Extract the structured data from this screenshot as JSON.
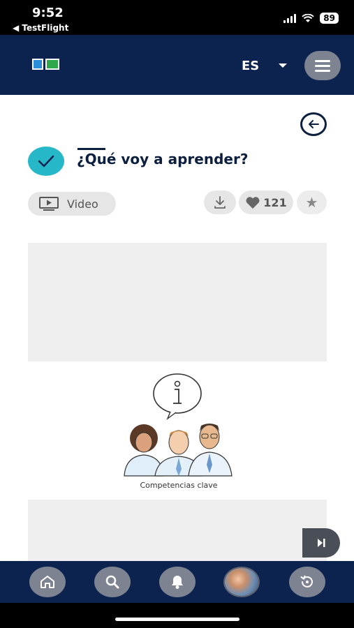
{
  "status_bar": {
    "time": "9:52",
    "back_app": "◀ TestFlight",
    "battery": "89"
  },
  "header": {
    "language": "ES",
    "brand_colors": {
      "navy": "#0c2350",
      "teal": "#26b8c8"
    }
  },
  "lesson": {
    "title": "¿Qué voy a aprender?",
    "media_type_label": "Video",
    "likes": "121"
  },
  "illustration": {
    "caption": "Competencias clave"
  },
  "icons": {
    "back": "arrow-left-icon",
    "check": "check-icon",
    "video": "video-icon",
    "download": "download-icon",
    "heart": "heart-icon",
    "star": "star-icon",
    "menu": "hamburger-icon",
    "skip": "skip-next-icon",
    "nav": [
      "home-icon",
      "search-icon",
      "bell-icon",
      "avatar",
      "history-icon"
    ]
  }
}
